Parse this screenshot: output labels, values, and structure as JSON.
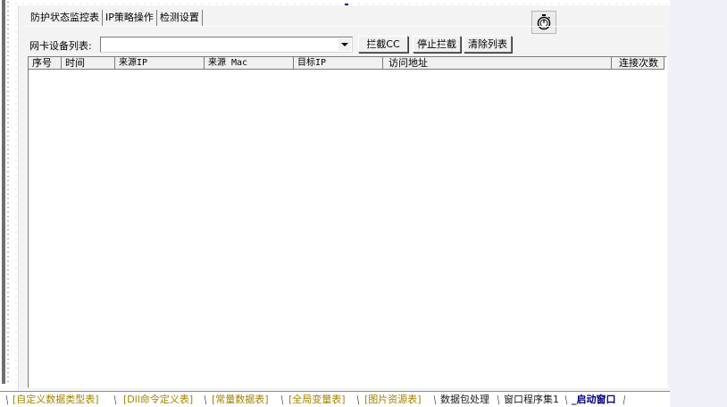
{
  "tabs": [
    {
      "label": "防护状态监控表"
    },
    {
      "label": "IP策略操作"
    },
    {
      "label": "检测设置"
    }
  ],
  "toolbar": {
    "device_label": "网卡设备列表:",
    "device_value": "",
    "btn_block": "拦截CC",
    "btn_stop": "停止拦截",
    "btn_clear": "清除列表"
  },
  "icons": {
    "stopwatch": "stopwatch-icon",
    "dropdown": "chevron-down-icon"
  },
  "table": {
    "columns": [
      "序号",
      "时间",
      "来源IP",
      "来源 Mac",
      "目标IP",
      "访问地址",
      "连接次数"
    ],
    "rows": []
  },
  "bottom_tabs": [
    {
      "label": "[自定义数据类型表]",
      "style": "olive"
    },
    {
      "label": "[Dll命令定义表]",
      "style": "olive"
    },
    {
      "label": "[常量数据表]",
      "style": "olive"
    },
    {
      "label": "[全局变量表]",
      "style": "olive"
    },
    {
      "label": "[图片资源表]",
      "style": "olive"
    },
    {
      "label": "数据包处理",
      "style": "dark"
    },
    {
      "label": "窗口程序集1",
      "style": "dark"
    },
    {
      "label": "_启动窗口",
      "style": "active"
    }
  ],
  "colors": {
    "form_bg": "#f3f3f3",
    "bottom_tab_olive": "#a28200",
    "bottom_tab_active": "#000080",
    "right_panel": "#eef2f8"
  }
}
